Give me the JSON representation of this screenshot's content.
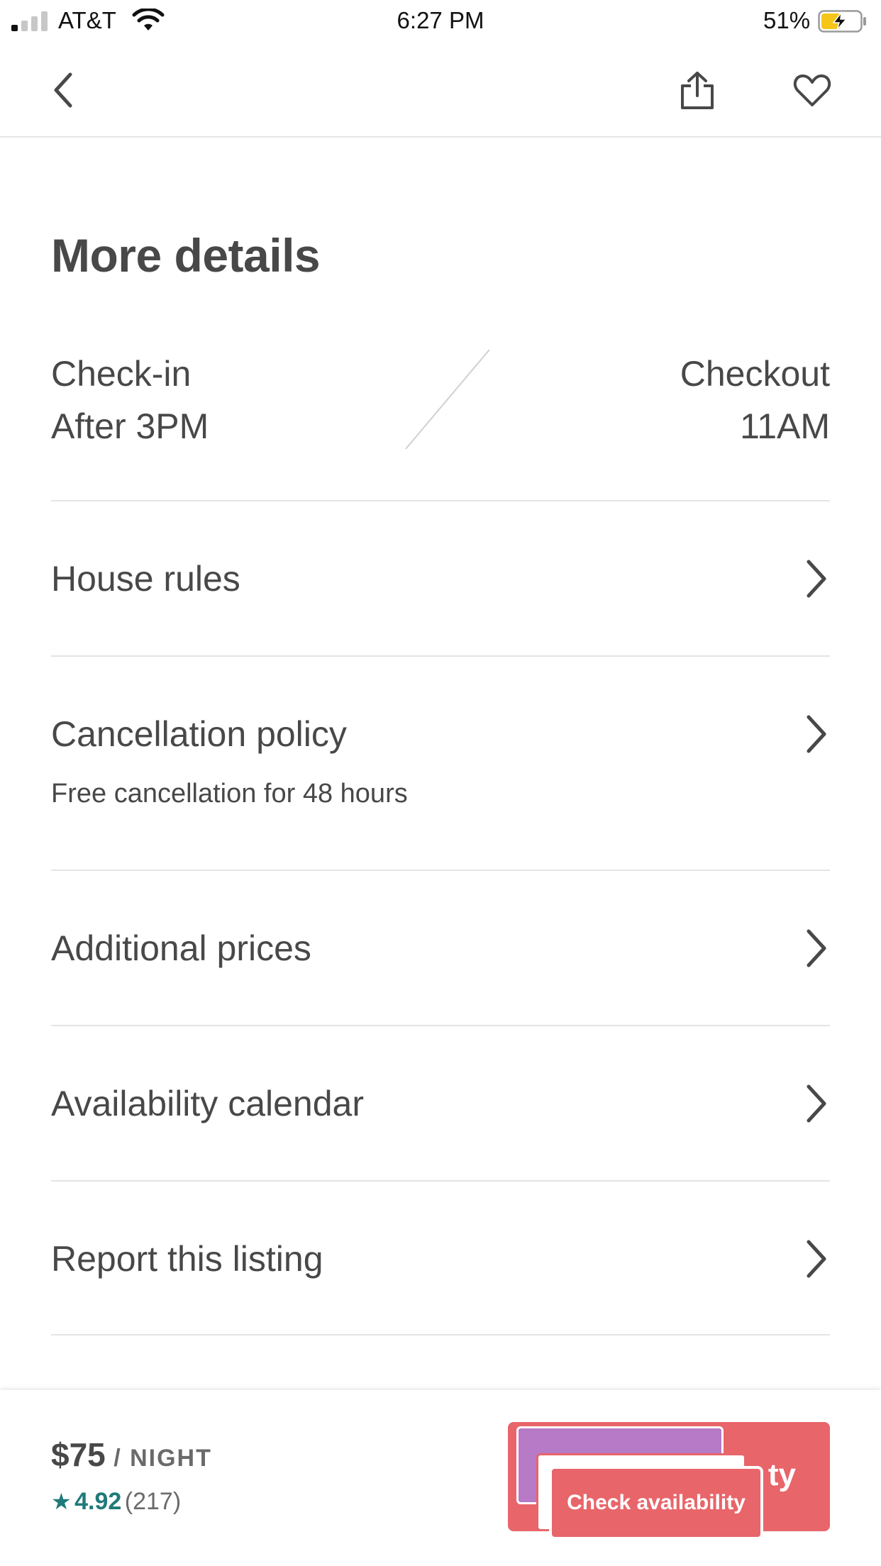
{
  "status_bar": {
    "carrier": "AT&T",
    "time": "6:27 PM",
    "battery_percent": "51%",
    "battery_level": 0.51,
    "battery_charging": true,
    "signal_bars_on": 1,
    "signal_bars_total": 4
  },
  "nav": {
    "icons": [
      "chevron-left-icon",
      "share-icon",
      "heart-icon"
    ]
  },
  "page": {
    "title": "More details"
  },
  "checkin": {
    "label": "Check-in",
    "value": "After 3PM"
  },
  "checkout": {
    "label": "Checkout",
    "value": "11AM"
  },
  "rows": [
    {
      "title": "House rules"
    },
    {
      "title": "Cancellation policy",
      "subtitle": "Free cancellation for 48 hours"
    },
    {
      "title": "Additional prices"
    },
    {
      "title": "Availability calendar"
    },
    {
      "title": "Report this listing"
    }
  ],
  "footer": {
    "price": "$75",
    "per_night": " / NIGHT",
    "star": "★",
    "rating": "4.92",
    "reviews": "(217)",
    "cta_back_label_fragment": "ty",
    "cta_label": "Check availability"
  },
  "colors": {
    "brand": "#e8656a",
    "rating": "#1f7a7a",
    "text": "#484848",
    "divider": "#e4e4e4"
  }
}
